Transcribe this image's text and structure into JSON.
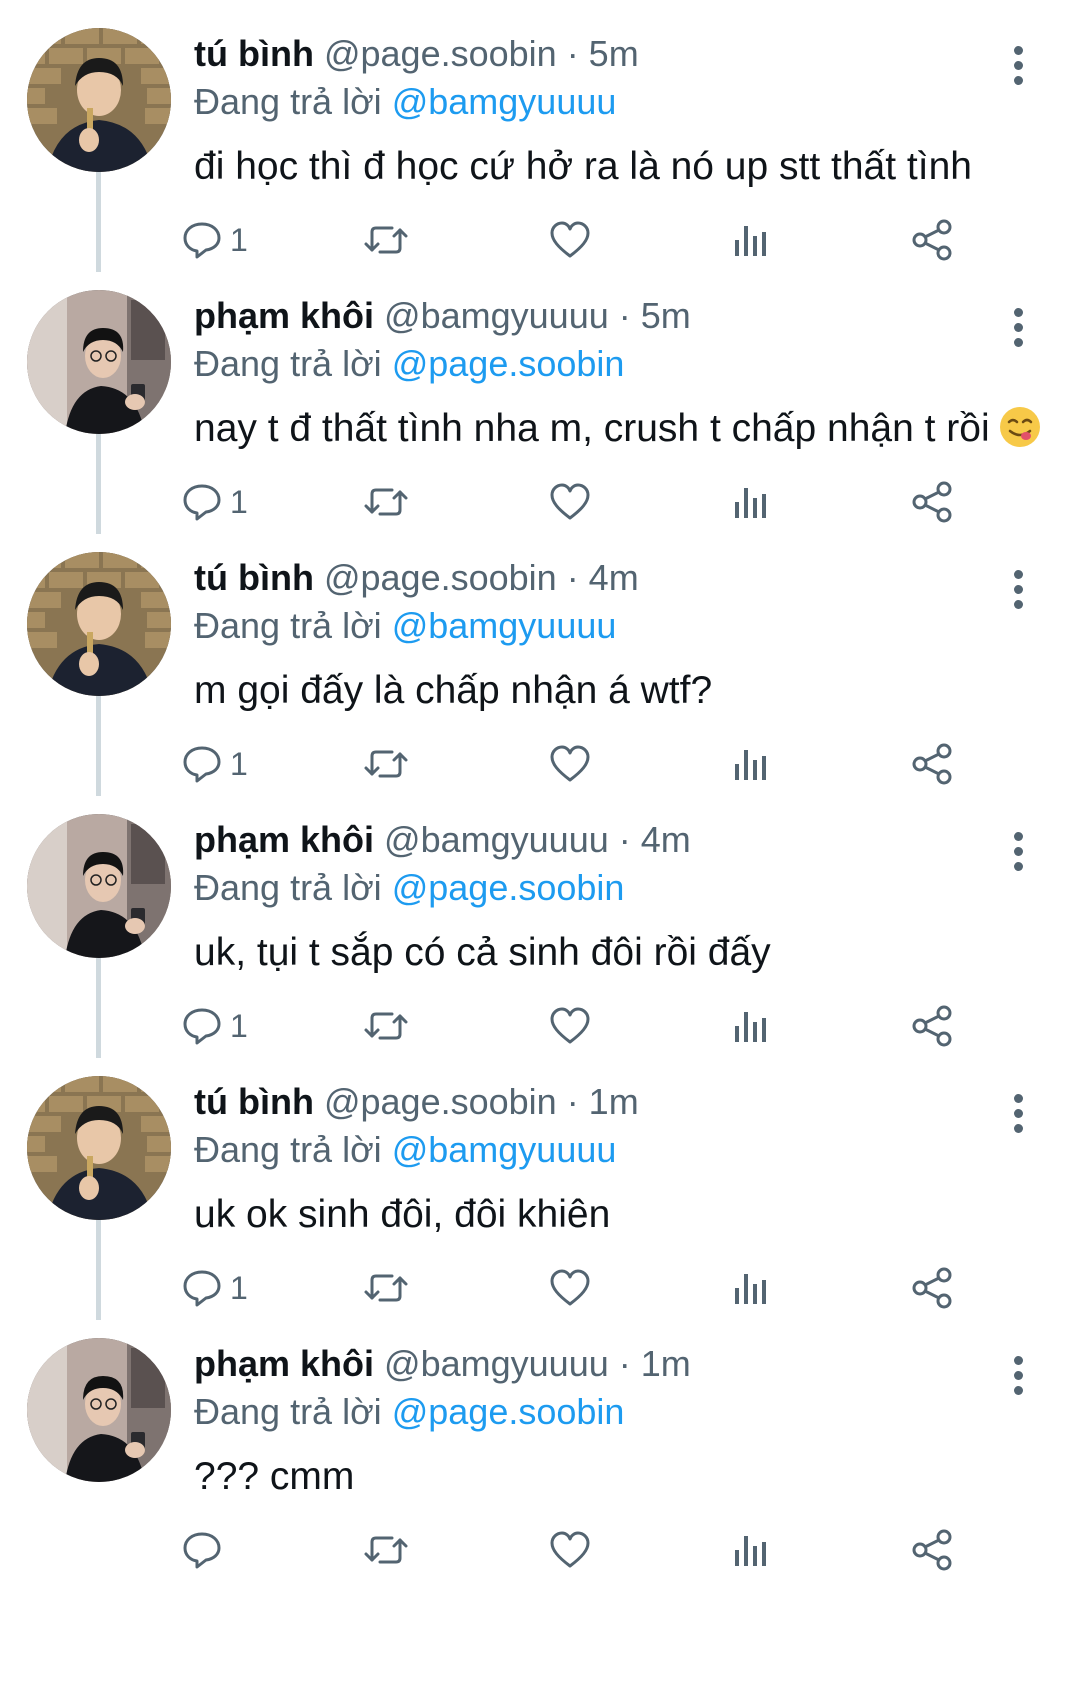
{
  "reply_prefix": "Đang trả lời",
  "tweets": [
    {
      "name": "tú bình",
      "meta": "@page.soobin · 5m",
      "reply_to": "@bamgyuuuu",
      "text": "đi học thì đ học cứ hở ra là nó up stt thất tình",
      "reply_count": "1",
      "avatar": "avatar-tu-binh",
      "emoji": ""
    },
    {
      "name": "phạm khôi",
      "meta": "@bamgyuuuu · 5m",
      "reply_to": "@page.soobin",
      "text": "nay t đ thất tình nha m, crush t chấp nhận t rồi",
      "reply_count": "1",
      "avatar": "avatar-pham-khoi",
      "emoji": "face-savoring-food-emoji"
    },
    {
      "name": "tú bình",
      "meta": "@page.soobin · 4m",
      "reply_to": "@bamgyuuuu",
      "text": "m gọi đấy là chấp nhận á wtf?",
      "reply_count": "1",
      "avatar": "avatar-tu-binh",
      "emoji": ""
    },
    {
      "name": "phạm khôi",
      "meta": "@bamgyuuuu · 4m",
      "reply_to": "@page.soobin",
      "text": "uk, tụi t sắp có cả sinh đôi rồi đấy",
      "reply_count": "1",
      "avatar": "avatar-pham-khoi",
      "emoji": ""
    },
    {
      "name": "tú bình",
      "meta": "@page.soobin · 1m",
      "reply_to": "@bamgyuuuu",
      "text": "uk ok sinh đôi, đôi khiên",
      "reply_count": "1",
      "avatar": "avatar-tu-binh",
      "emoji": ""
    },
    {
      "name": "phạm khôi",
      "meta": "@bamgyuuuu · 1m",
      "reply_to": "@page.soobin",
      "text": "??? cmm",
      "reply_count": "",
      "avatar": "avatar-pham-khoi",
      "emoji": ""
    }
  ],
  "colors": {
    "text": "#0f1419",
    "secondary": "#536471",
    "link": "#1d9bf0",
    "thread_line": "#cfd9de"
  },
  "icons": [
    "reply-icon",
    "retweet-icon",
    "like-icon",
    "analytics-icon",
    "share-icon",
    "more-icon"
  ]
}
